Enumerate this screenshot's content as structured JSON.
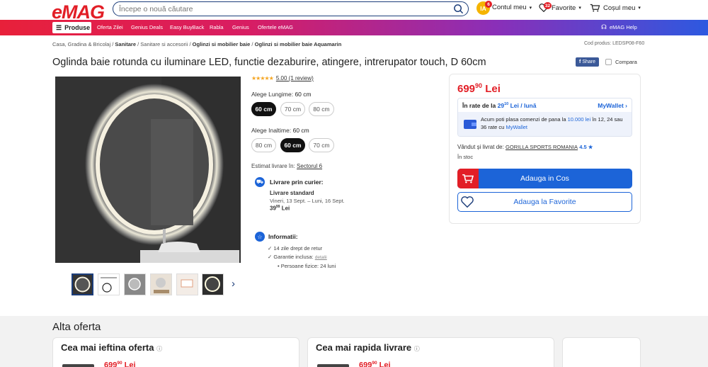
{
  "header": {
    "logo": "eMAG",
    "search_placeholder": "Începe o nouă căutare",
    "account_initials": "IA",
    "account_badge": "6",
    "account_label": "Contul meu",
    "favorites_label": "Favorite",
    "favorites_badge": "32",
    "cart_label": "Coșul meu"
  },
  "nav": {
    "produse": "Produse",
    "links": [
      "Oferta Zilei",
      "Genius Deals",
      "Easy BuyBack",
      "Rabla",
      "Genius",
      "Ofertele eMAG"
    ],
    "help": "eMAG Help"
  },
  "breadcrumb": [
    "Casa, Gradina & Bricolaj",
    "Sanitare",
    "Sanitare si accesorii",
    "Oglinzi si mobilier baie",
    "Oglinzi si mobilier baie Aquamarin"
  ],
  "product_code": "Cod produs: LEDSP08-F60",
  "title": "Oglinda baie rotunda cu iluminare LED, functie dezaburire, atingere, intrerupator touch, D 60cm",
  "share_label": "Share",
  "compare_label": "Compara",
  "rating": {
    "stars": "★★★★★",
    "text": "5.00 (1 review)"
  },
  "options": {
    "length_label": "Alege Lungime:",
    "length_value": "60 cm",
    "length_pills": [
      "60 cm",
      "70 cm",
      "80 cm"
    ],
    "height_label": "Alege Inaltime:",
    "height_value": "60 cm",
    "height_pills": [
      "80 cm",
      "60 cm",
      "70 cm"
    ]
  },
  "delivery": {
    "estimate_label": "Estimat livrare în:",
    "estimate_loc": "Sectorul 6",
    "courier_title": "Livrare prin curier:",
    "standard": "Livrare standard",
    "dates": "Vineri, 13 Sept. – Luni, 16 Sept.",
    "cost_int": "39",
    "cost_dec": "99",
    "cost_cur": "Lei"
  },
  "info": {
    "title": "Informatii:",
    "return": "14 zile drept de retur",
    "warranty": "Garantie inclusa:",
    "warranty_link": "detalii",
    "persons": "Persoane fizice: 24 luni"
  },
  "price": {
    "int": "699",
    "dec": "90",
    "cur": "Lei"
  },
  "installments": {
    "label": "În rate de la",
    "value_int": "29",
    "value_dec": "10",
    "unit": "Lei / lună",
    "wallet": "MyWallet",
    "line1a": "Acum poti plasa comenzi de pana la",
    "line1b": "10.000 lei",
    "line1c": "în 12, 24 sau",
    "line2a": "36 rate cu",
    "line2b": "MyWallet"
  },
  "seller": {
    "label": "Vândut și livrat de:",
    "name": "GORILLA SPORTS ROMANIA",
    "score": "4.5 ★",
    "stock": "În stoc"
  },
  "buttons": {
    "cart": "Adauga in Cos",
    "favorite": "Adauga la Favorite"
  },
  "other_offers": {
    "title": "Alta oferta",
    "cheapest": "Cea mai ieftina oferta",
    "fastest": "Cea mai rapida livrare",
    "price_int": "699",
    "price_dec": "90",
    "price_cur": "Lei"
  },
  "colors": {
    "brand_red": "#e21e26",
    "brand_blue": "#1c64d8",
    "navy": "#1c3d7a"
  }
}
